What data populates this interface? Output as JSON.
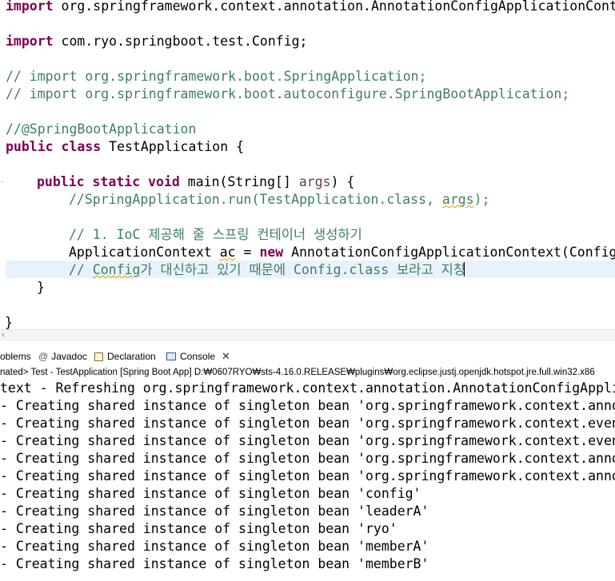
{
  "editor": {
    "lines": {
      "l1": {
        "kw": "import",
        "rest": " org.springframework.context.annotation.AnnotationConfigApplicationCont"
      },
      "l2": {
        "kw": "import",
        "rest": " com.ryo.springboot.test.Config;"
      },
      "l3": "// import org.springframework.boot.SpringApplication;",
      "l4": "// import org.springframework.boot.autoconfigure.SpringBootApplication;",
      "l5": "//@SpringBootApplication",
      "l6": {
        "kw1": "public",
        "kw2": "class",
        "rest": " TestApplication {"
      },
      "l7": {
        "kw1": "public",
        "kw2": "static",
        "kw3": "void",
        "pre": " main(String[] ",
        "arg": "args",
        "post": ") {"
      },
      "l8": {
        "pre": "//SpringApplication.run(TestApplication.class, ",
        "arg": "args",
        "post": ");"
      },
      "l9": "// 1. IoC 제공해 줄 스프링 컨테이너 생성하기",
      "l10": {
        "pre": "ApplicationContext ",
        "var": "ac",
        "mid": " = ",
        "kw": "new",
        "post": " AnnotationConfigApplicationContext(Config"
      },
      "l11": {
        "pre": "// ",
        "word": "Config",
        "post": "가 대신하고 있기 때문에 Config.class 보라고 지칭"
      },
      "l12": "}",
      "l13": "}"
    }
  },
  "tabs": {
    "problems": "oblems",
    "javadoc": "Javadoc",
    "declaration": "Declaration",
    "console": "Console"
  },
  "console": {
    "header": "nated> Test - TestApplication [Spring Boot App] D:₩0607RYO₩sts-4.16.0.RELEASE₩plugins₩org.eclipse.justj.openjdk.hotspot.jre.full.win32.x86",
    "lines": [
      "text - Refreshing org.springframework.context.annotation.AnnotationConfigAppli",
      "- Creating shared instance of singleton bean 'org.springframework.context.anno",
      "- Creating shared instance of singleton bean 'org.springframework.context.even",
      "- Creating shared instance of singleton bean 'org.springframework.context.even",
      "- Creating shared instance of singleton bean 'org.springframework.context.anno",
      "- Creating shared instance of singleton bean 'org.springframework.context.anno",
      "- Creating shared instance of singleton bean 'config'",
      "- Creating shared instance of singleton bean 'leaderA'",
      "- Creating shared instance of singleton bean 'ryo'",
      "- Creating shared instance of singleton bean 'memberA'",
      "- Creating shared instance of singleton bean 'memberB'"
    ]
  },
  "colors": {
    "keyword": "#7f0055",
    "comment": "#3f7f5f",
    "current_line": "#e8f2fe"
  },
  "icons": {
    "javadoc": "at-icon",
    "declaration": "declaration-icon",
    "console": "console-icon",
    "close": "close-icon"
  }
}
